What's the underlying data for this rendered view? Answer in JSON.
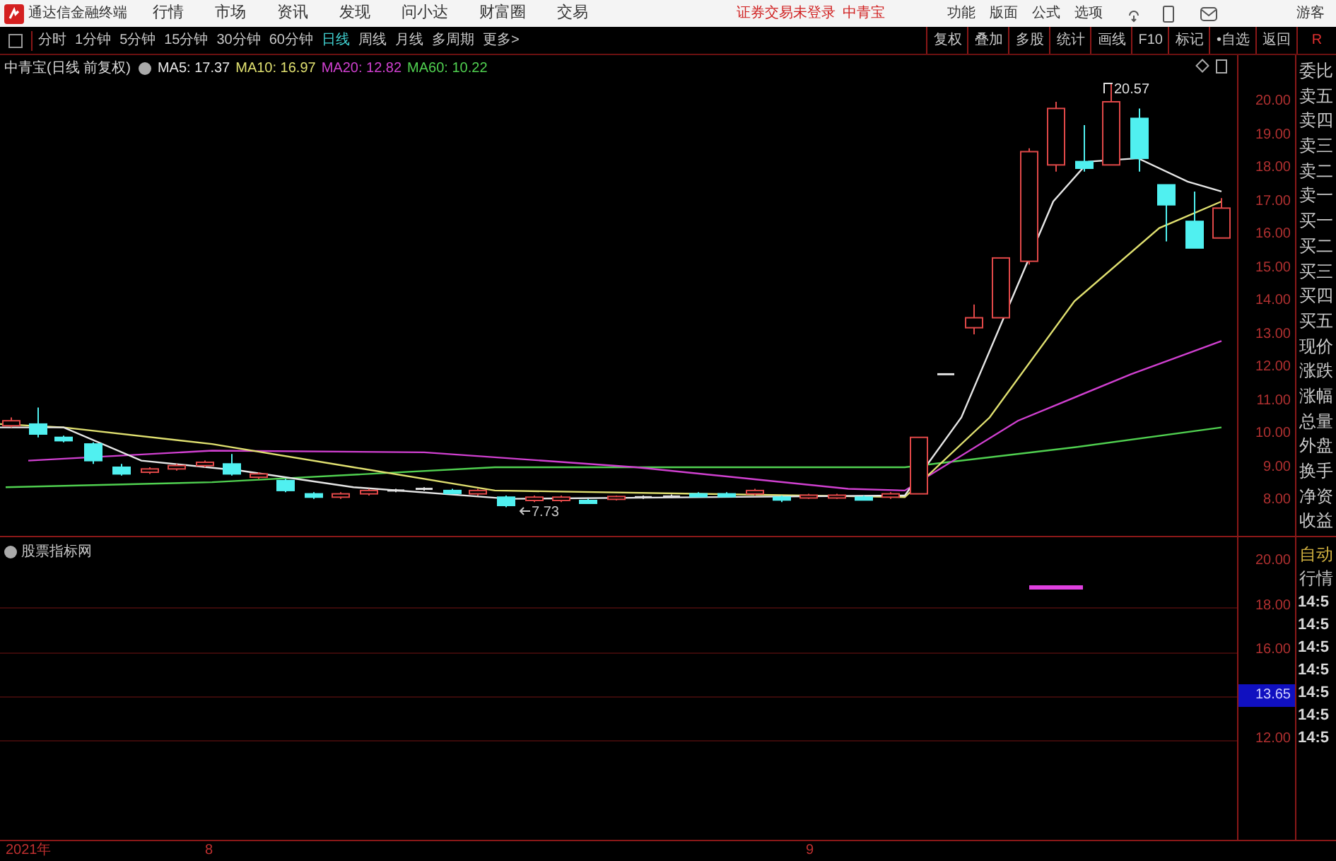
{
  "window": {
    "app_title": "通达信金融终端",
    "menu": [
      "行情",
      "市场",
      "资讯",
      "发现",
      "问小达",
      "财富圈",
      "交易"
    ],
    "login_status": "证券交易未登录",
    "stock_name": "中青宝",
    "right_menu": [
      "功能",
      "版面",
      "公式",
      "选项"
    ],
    "user": "游客"
  },
  "periods": [
    {
      "label": "分时",
      "selected": false
    },
    {
      "label": "1分钟",
      "selected": false
    },
    {
      "label": "5分钟",
      "selected": false
    },
    {
      "label": "15分钟",
      "selected": false
    },
    {
      "label": "30分钟",
      "selected": false
    },
    {
      "label": "60分钟",
      "selected": false
    },
    {
      "label": "日线",
      "selected": true
    },
    {
      "label": "周线",
      "selected": false
    },
    {
      "label": "月线",
      "selected": false
    },
    {
      "label": "多周期",
      "selected": false
    },
    {
      "label": "更多>",
      "selected": false
    }
  ],
  "toolbar_buttons": [
    "复权",
    "叠加",
    "多股",
    "统计",
    "画线",
    "F10",
    "标记",
    "•自选",
    "返回"
  ],
  "corner_label": "R",
  "chart": {
    "title": "中青宝(日线 前复权)",
    "ma": [
      {
        "label": "MA5: 17.37",
        "color": "#e6e6e6"
      },
      {
        "label": "MA10: 16.97",
        "color": "#e0e070"
      },
      {
        "label": "MA20: 12.82",
        "color": "#d040d0"
      },
      {
        "label": "MA60: 10.22",
        "color": "#50d050"
      }
    ],
    "high_label": "20.57",
    "low_label": "7.73",
    "y_labels": [
      "20.00",
      "19.00",
      "18.00",
      "17.00",
      "16.00",
      "15.00",
      "14.00",
      "13.00",
      "12.00",
      "11.00",
      "10.00",
      "9.00",
      "8.00"
    ]
  },
  "quote_labels": [
    "委比",
    "卖五",
    "卖四",
    "卖三",
    "卖二",
    "卖一",
    "买一",
    "买二",
    "买三",
    "买四",
    "买五",
    "现价",
    "涨跌",
    "涨幅",
    "总量",
    "外盘",
    "换手",
    "净资",
    "收益"
  ],
  "indicator": {
    "title": "股票指标网",
    "y_labels": [
      {
        "text": "20.00",
        "kind": "tick"
      },
      {
        "text": "18.00",
        "kind": "tick"
      },
      {
        "text": "16.00",
        "kind": "tick"
      },
      {
        "text": "13.65",
        "kind": "current"
      },
      {
        "text": "12.00",
        "kind": "tick"
      }
    ],
    "side_labels": [
      {
        "text": "自动",
        "color": "#d0b040"
      },
      {
        "text": "行情",
        "color": "#c0c0c0"
      }
    ],
    "times": [
      "14:5",
      "14:5",
      "14:5",
      "14:5",
      "14:5",
      "14:5",
      "14:5"
    ]
  },
  "date_axis": [
    "2021年",
    "8",
    "9"
  ]
}
